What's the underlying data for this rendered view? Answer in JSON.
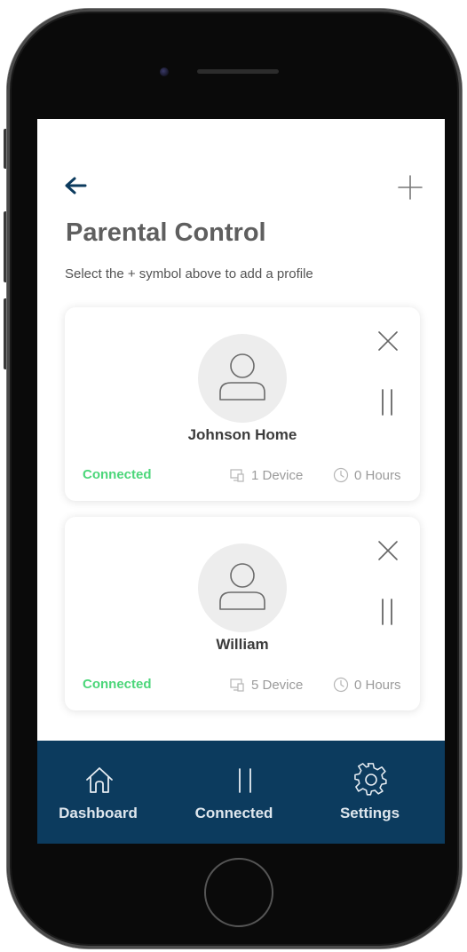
{
  "header": {
    "back_icon": "arrow-left-icon",
    "add_icon": "plus-icon",
    "title": "Parental Control",
    "subtitle": "Select the + symbol above to add a profile"
  },
  "profiles": [
    {
      "name": "Johnson Home",
      "status": "Connected",
      "devices": "1 Device",
      "hours": "0 Hours"
    },
    {
      "name": "William",
      "status": "Connected",
      "devices": "5 Device",
      "hours": "0 Hours"
    }
  ],
  "bottom_nav": {
    "items": [
      {
        "label": "Dashboard",
        "icon": "home-icon"
      },
      {
        "label": "Connected",
        "icon": "pause-icon"
      },
      {
        "label": "Settings",
        "icon": "gear-icon"
      }
    ]
  },
  "colors": {
    "accent_navy": "#0c3b5e",
    "status_green": "#4cd67a",
    "title_gray": "#5f5f5f"
  }
}
